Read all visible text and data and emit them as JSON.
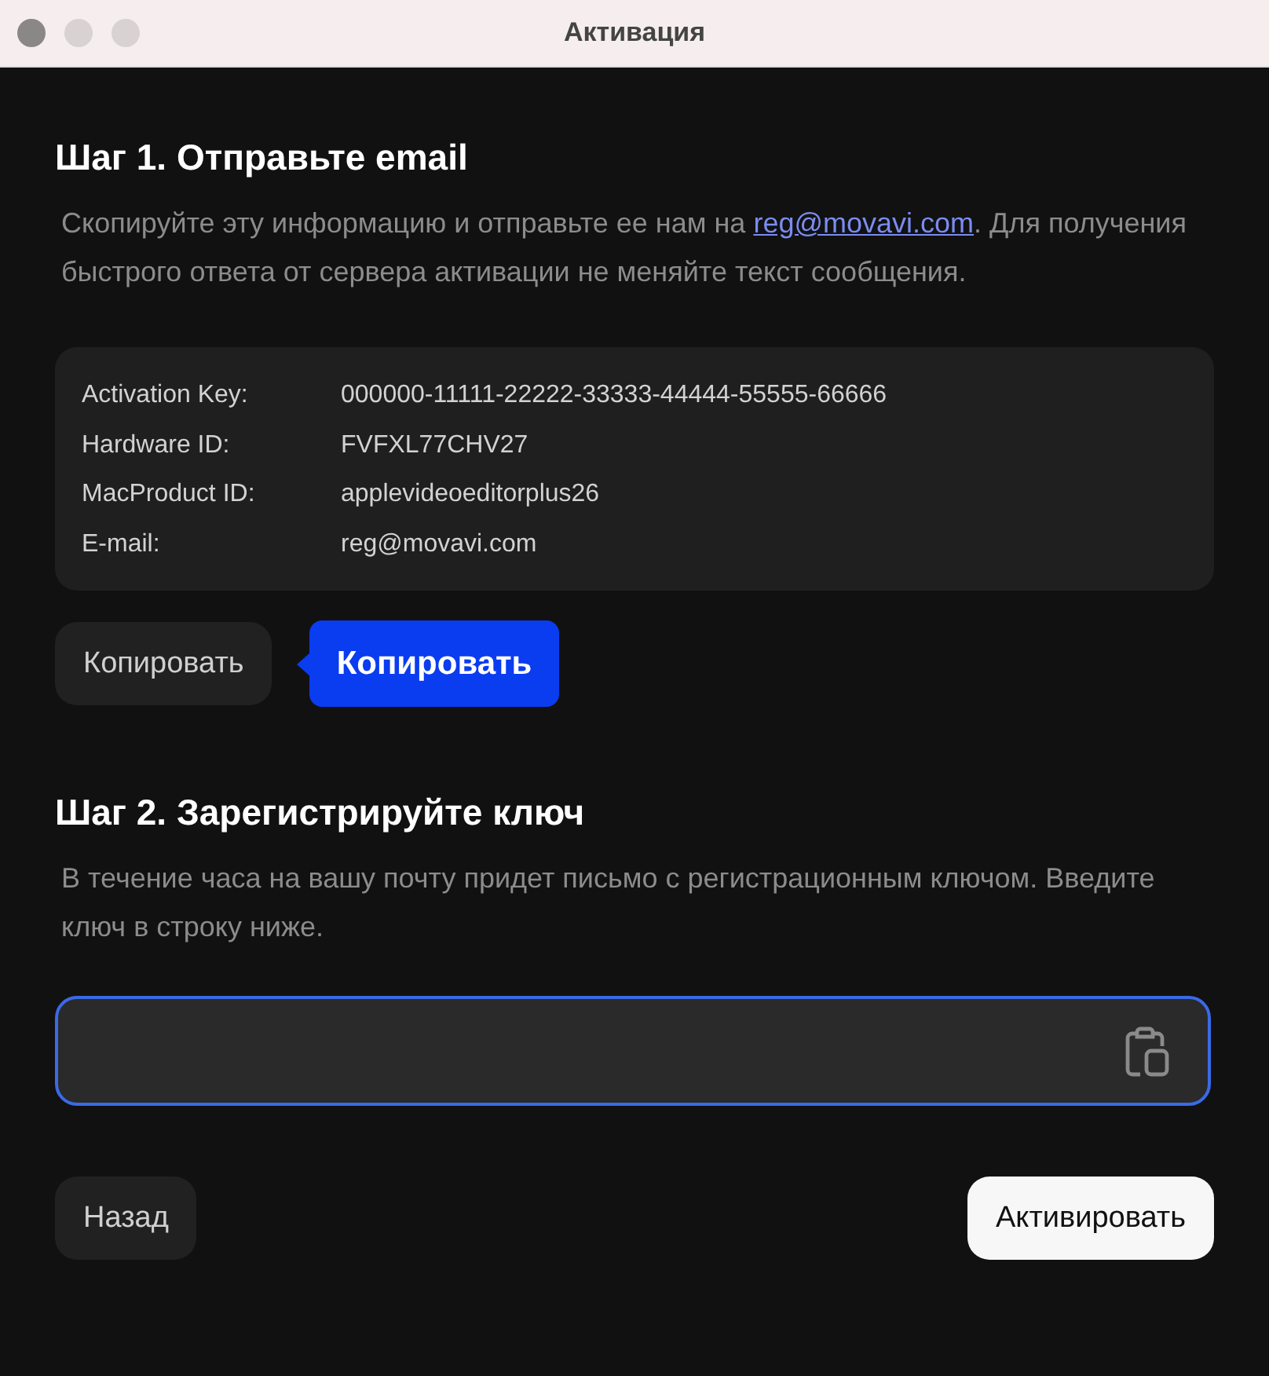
{
  "window": {
    "title": "Активация"
  },
  "step1": {
    "heading": "Шаг 1. Отправьте email",
    "text_before": "Скопируйте эту информацию и отправьте ее нам на ",
    "link": "reg@movavi.com",
    "text_after": ". Для получения быстрого ответа от сервера активации не меняйте текст сообщения."
  },
  "info": [
    {
      "label": "Activation Key:",
      "value": "000000-11111-22222-33333-44444-55555-66666"
    },
    {
      "label": "Hardware ID:",
      "value": "FVFXL77CHV27"
    },
    {
      "label": "MacProduct ID:",
      "value": "applevideoeditorplus26"
    },
    {
      "label": "E-mail:",
      "value": "reg@movavi.com"
    }
  ],
  "copy_button": "Копировать",
  "tooltip": "Копировать",
  "step2": {
    "heading": "Шаг 2. Зарегистрируйте ключ",
    "text": "В течение часа на вашу почту придет письмо с регистрационным ключом. Введите ключ в строку ниже."
  },
  "key_field": {
    "focused": true
  },
  "buttons": [
    {
      "label": "Назад",
      "kind": "secondary"
    },
    {
      "label": "Активировать",
      "kind": "primary"
    }
  ]
}
